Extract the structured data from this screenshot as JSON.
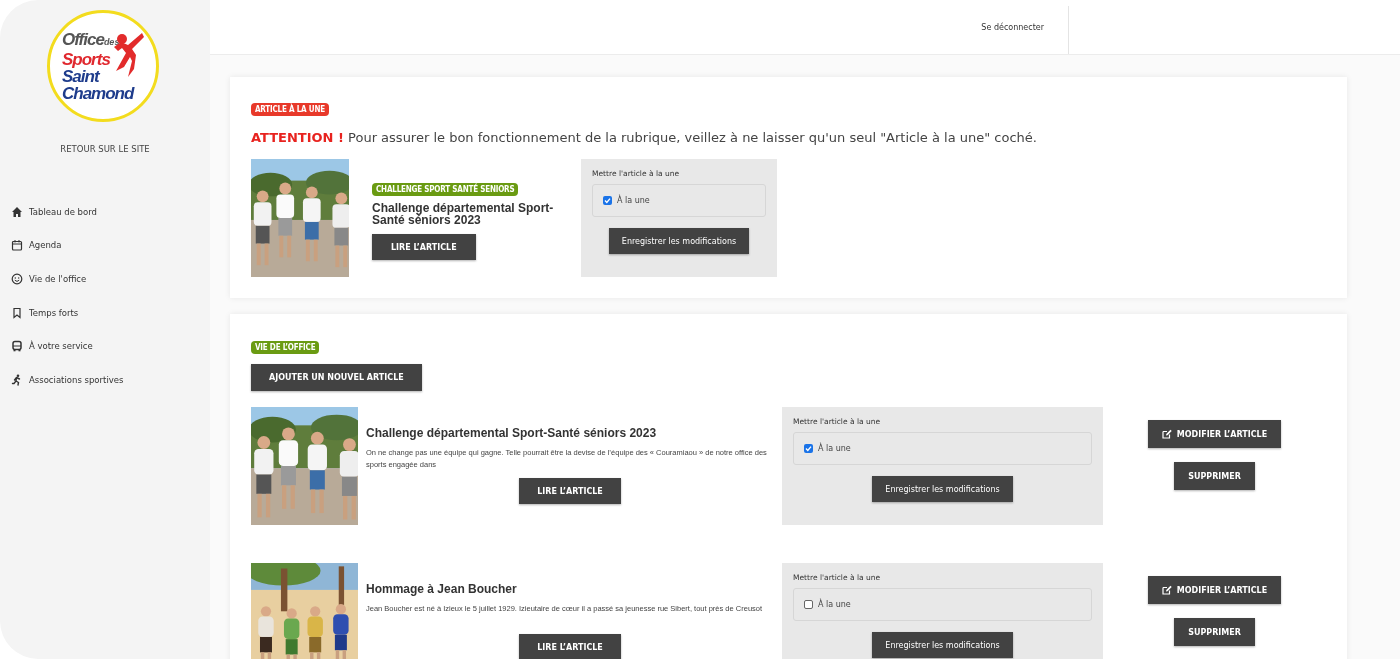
{
  "sidebar": {
    "logo": {
      "lines": [
        "Office",
        "des",
        "Sports",
        "Saint",
        "Chamond"
      ]
    },
    "back_link": "RETOUR SUR LE SITE",
    "items": [
      {
        "label": "Tableau de bord"
      },
      {
        "label": "Agenda"
      },
      {
        "label": "Vie de l'office"
      },
      {
        "label": "Temps forts"
      },
      {
        "label": "À votre service"
      },
      {
        "label": "Associations sportives"
      }
    ]
  },
  "topbar": {
    "logout": "Se déconnecter"
  },
  "featured": {
    "badge": "ARTICLE À LA UNE",
    "warning": "**ATTENTION !** Pour assurer le bon fonctionnement de la rubrique, veillez à ne laisser qu'un seul \"Article à la une\" coché.",
    "article": {
      "category": "CHALLENGE SPORT SANTÉ SENIORS",
      "title": "Challenge départemental Sport-Santé séniors 2023",
      "read_button": "LIRE L’ARTICLE"
    },
    "feature_box": {
      "label": "Mettre l'article à la une",
      "checkbox_label": "À la une",
      "checked": true,
      "save_button": "Enregistrer les modifications"
    }
  },
  "section": {
    "badge": "VIE DE L’OFFICE",
    "add_button": "AJOUTER UN NOUVEL ARTICLE",
    "articles": [
      {
        "title": "Challenge départemental Sport-Santé séniors 2023",
        "excerpt": "On ne change pas une équipe qui gagne. Telle pourrait être la devise de l’équipe des « Couramiaou » de notre office des sports engagée dans",
        "read_button": "LIRE L’ARTICLE",
        "feature_box": {
          "label": "Mettre l'article à la une",
          "checkbox_label": "À la une",
          "checked": true,
          "save_button": "Enregistrer les modifications"
        },
        "edit_button": "MODIFIER L’ARTICLE",
        "delete_button": "SUPPRIMER"
      },
      {
        "title": "Hommage à Jean Boucher",
        "excerpt": "Jean Boucher est né à Izieux le 5 juillet 1929. Izieutaire de cœur il a passé sa jeunesse rue Sibert, tout près de Creusot",
        "read_button": "LIRE L’ARTICLE",
        "feature_box": {
          "label": "Mettre l'article à la une",
          "checkbox_label": "À la une",
          "checked": false,
          "save_button": "Enregistrer les modifications"
        },
        "edit_button": "MODIFIER L’ARTICLE",
        "delete_button": "SUPPRIMER"
      }
    ]
  }
}
